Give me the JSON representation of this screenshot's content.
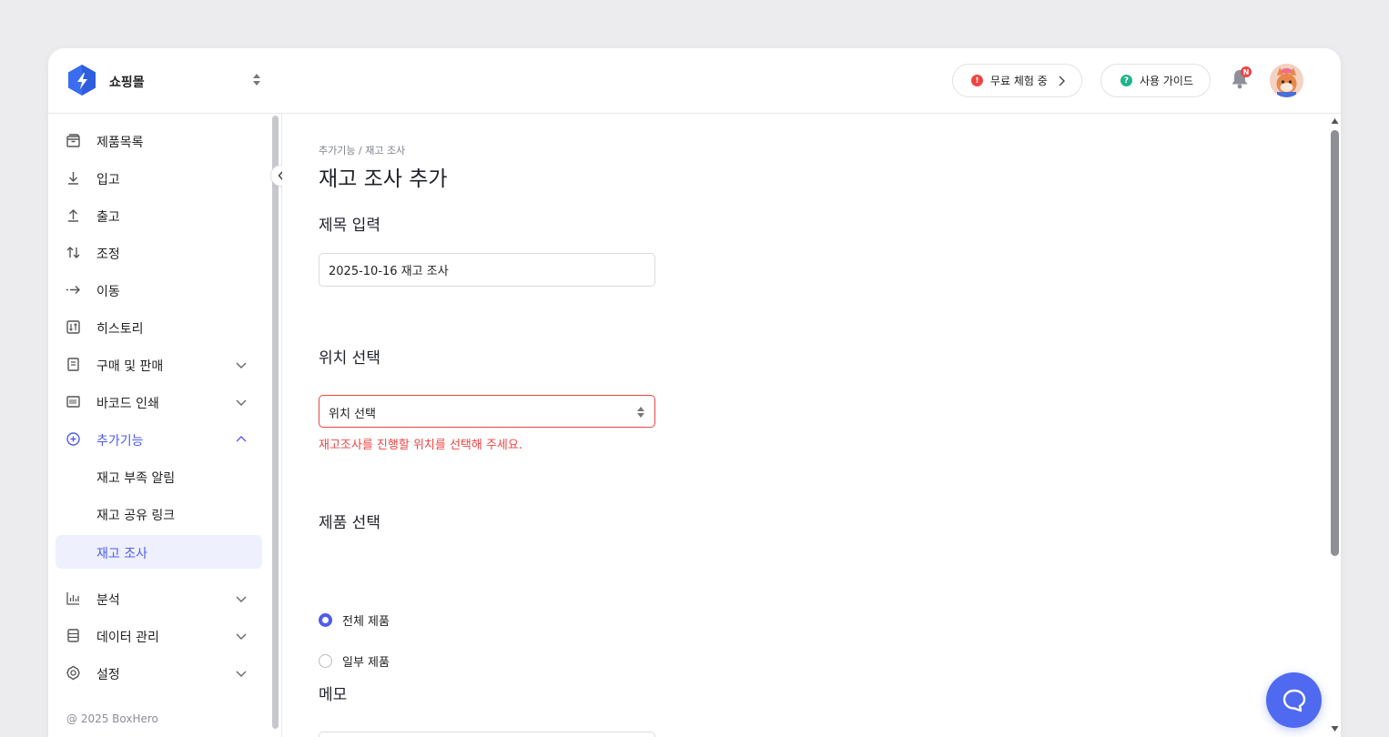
{
  "header": {
    "store_name": "쇼핑몰",
    "trial_label": "무료 체험 중",
    "trial_badge": "!",
    "guide_label": "사용 가이드",
    "guide_badge": "?",
    "bell_badge": "N",
    "colors": {
      "accent": "#4f5dec",
      "trial_dot": "#ef4444",
      "guide_dot": "#22b38a",
      "logo": "#3b6df0"
    }
  },
  "sidebar": {
    "items": [
      {
        "label": "제품목록",
        "icon": "box-icon"
      },
      {
        "label": "입고",
        "icon": "arrow-down-icon"
      },
      {
        "label": "출고",
        "icon": "arrow-up-icon"
      },
      {
        "label": "조정",
        "icon": "swap-vertical-icon"
      },
      {
        "label": "이동",
        "icon": "dashed-arrow-right-icon"
      },
      {
        "label": "히스토리",
        "icon": "history-icon"
      },
      {
        "label": "구매 및 판매",
        "icon": "document-icon"
      },
      {
        "label": "바코드 인쇄",
        "icon": "barcode-icon"
      },
      {
        "label": "추가기능",
        "icon": "plus-circle-icon"
      },
      {
        "label": "재고 부족 알림"
      },
      {
        "label": "재고 공유 링크"
      },
      {
        "label": "재고 조사"
      },
      {
        "label": "분석",
        "icon": "bar-chart-icon"
      },
      {
        "label": "데이터 관리",
        "icon": "database-icon"
      },
      {
        "label": "설정",
        "icon": "gear-icon"
      }
    ],
    "footer": "@ 2025 BoxHero"
  },
  "main": {
    "breadcrumb": {
      "parent": "추가기능",
      "separator": "/",
      "current": "재고 조사"
    },
    "title": "재고 조사 추가",
    "title_section": {
      "label": "제목 입력",
      "value": "2025-10-16 재고 조사"
    },
    "location_section": {
      "label": "위치 선택",
      "select_value": "위치 선택",
      "error": "재고조사를 진행할 위치를 선택해 주세요."
    },
    "product_section": {
      "label": "제품 선택",
      "options": [
        {
          "label": "전체 제품",
          "checked": true
        },
        {
          "label": "일부 제품",
          "checked": false
        }
      ]
    },
    "memo_section": {
      "label": "메모"
    }
  }
}
